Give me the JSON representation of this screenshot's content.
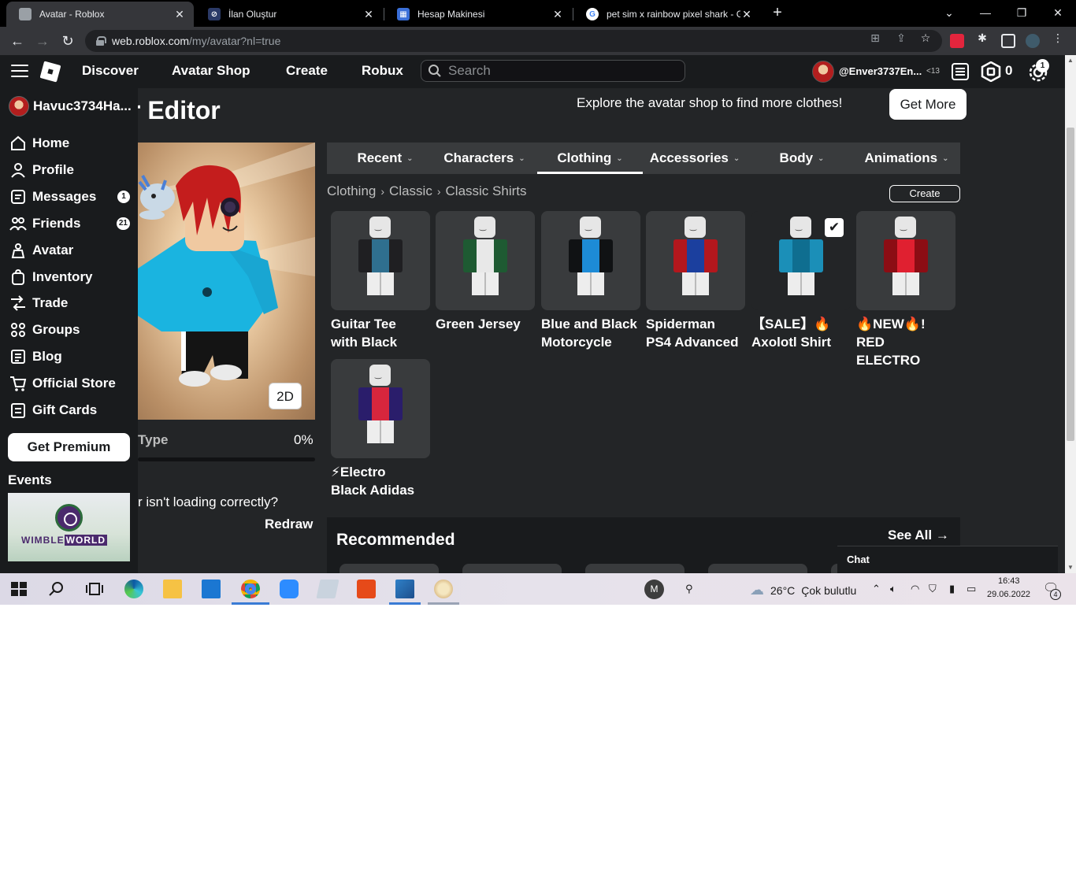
{
  "browser": {
    "tabs": [
      {
        "title": "Avatar - Roblox",
        "active": true
      },
      {
        "title": "İlan Oluştur",
        "active": false
      },
      {
        "title": "Hesap Makinesi",
        "active": false
      },
      {
        "title": "pet sim x rainbow pixel shark - G",
        "active": false
      }
    ],
    "url_host": "web.roblox.com",
    "url_path": "/my/avatar?nl=true"
  },
  "nav": {
    "links": [
      "Discover",
      "Avatar Shop",
      "Create",
      "Robux"
    ],
    "search_placeholder": "Search",
    "username": "@Enver3737En...",
    "age_label": "<13",
    "robux": "0",
    "notifications": "1"
  },
  "sidebar": {
    "username": "Havuc3734Ha...",
    "items": [
      {
        "label": "Home",
        "icon": "home-icon",
        "badge": ""
      },
      {
        "label": "Profile",
        "icon": "profile-icon",
        "badge": ""
      },
      {
        "label": "Messages",
        "icon": "messages-icon",
        "badge": "1"
      },
      {
        "label": "Friends",
        "icon": "friends-icon",
        "badge": "21"
      },
      {
        "label": "Avatar",
        "icon": "avatar-icon",
        "badge": ""
      },
      {
        "label": "Inventory",
        "icon": "inventory-icon",
        "badge": ""
      },
      {
        "label": "Trade",
        "icon": "trade-icon",
        "badge": ""
      },
      {
        "label": "Groups",
        "icon": "groups-icon",
        "badge": ""
      },
      {
        "label": "Blog",
        "icon": "blog-icon",
        "badge": ""
      },
      {
        "label": "Official Store",
        "icon": "cart-icon",
        "badge": ""
      },
      {
        "label": "Gift Cards",
        "icon": "gift-card-icon",
        "badge": ""
      }
    ],
    "premium_label": "Get Premium",
    "events_label": "Events",
    "event_banner": {
      "text_a": "WIMBLE",
      "text_b": "WORLD"
    }
  },
  "editor": {
    "title": "Avatar Editor",
    "explore_text": "Explore the avatar shop to find more clothes!",
    "get_more_label": "Get More",
    "view_toggle_label": "2D",
    "scale_label": "Type",
    "scale_value": "0%",
    "scale_fraction": 0,
    "loading_question": "r isn't loading correctly?",
    "redraw_label": "Redraw",
    "category_tabs": [
      {
        "label": "Recent",
        "active": false
      },
      {
        "label": "Characters",
        "active": false
      },
      {
        "label": "Clothing",
        "active": true
      },
      {
        "label": "Accessories",
        "active": false
      },
      {
        "label": "Body",
        "active": false
      },
      {
        "label": "Animations",
        "active": false
      }
    ],
    "breadcrumb": [
      "Clothing",
      "Classic",
      "Classic Shirts"
    ],
    "create_label": "Create",
    "items": [
      {
        "name_line1": "Guitar Tee",
        "name_line2": "with Black",
        "equipped": false,
        "color": "#1f1f22",
        "accent": "#2f6f8f"
      },
      {
        "name_line1": "Green Jersey",
        "name_line2": "",
        "equipped": false,
        "color": "#1e5a32",
        "accent": "#e8e8e8"
      },
      {
        "name_line1": "Blue and Black",
        "name_line2": "Motorcycle",
        "equipped": false,
        "color": "#101214",
        "accent": "#1d8bd6"
      },
      {
        "name_line1": "Spiderman",
        "name_line2": "PS4 Advanced",
        "equipped": false,
        "color": "#b3171d",
        "accent": "#1b3f9e"
      },
      {
        "name_line1": "【SALE】🔥",
        "name_line2": "Axolotl Shirt",
        "equipped": true,
        "color": "#1b8fb8",
        "accent": "#0f6e90"
      },
      {
        "name_line1": "🔥NEW🔥! RED",
        "name_line2": "ELECTRO",
        "equipped": false,
        "color": "#8c0d14",
        "accent": "#e02030"
      },
      {
        "name_line1": "⚡Electro",
        "name_line2": "Black Adidas",
        "equipped": false,
        "color": "#2a1d6b",
        "accent": "#d7263d"
      }
    ],
    "recommended_title": "Recommended",
    "see_all_label": "See All",
    "chat_label": "Chat"
  },
  "taskbar": {
    "user_initial": "M",
    "temperature": "26°C",
    "weather_text": "Çok bulutlu",
    "time": "16:43",
    "date": "29.06.2022",
    "notification_count": "4"
  },
  "colors": {
    "page_bg": "#232527",
    "nav_bg": "#191b1d",
    "card_bg": "#393b3d"
  }
}
